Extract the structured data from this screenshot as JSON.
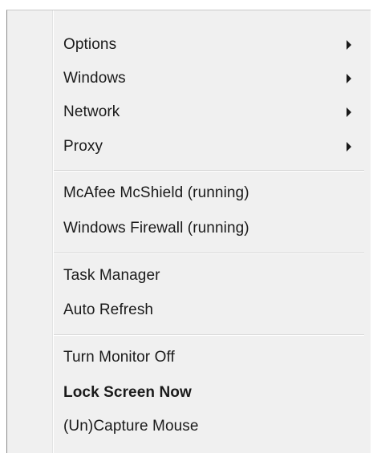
{
  "menu": {
    "group1": [
      {
        "label": "Options",
        "submenu_icon": "triangle-right-icon"
      },
      {
        "label": "Windows",
        "submenu_icon": "triangle-right-icon"
      },
      {
        "label": "Network",
        "submenu_icon": "triangle-right-icon"
      },
      {
        "label": "Proxy",
        "submenu_icon": "triangle-right-icon"
      }
    ],
    "group2": [
      {
        "label": "McAfee McShield (running)"
      },
      {
        "label": "Windows Firewall (running)"
      }
    ],
    "group3": [
      {
        "label": "Task Manager"
      },
      {
        "label": "Auto Refresh"
      }
    ],
    "group4": [
      {
        "label": "Turn Monitor Off"
      },
      {
        "label": "Lock Screen Now",
        "default": true
      },
      {
        "label": "(Un)Capture Mouse"
      }
    ]
  }
}
